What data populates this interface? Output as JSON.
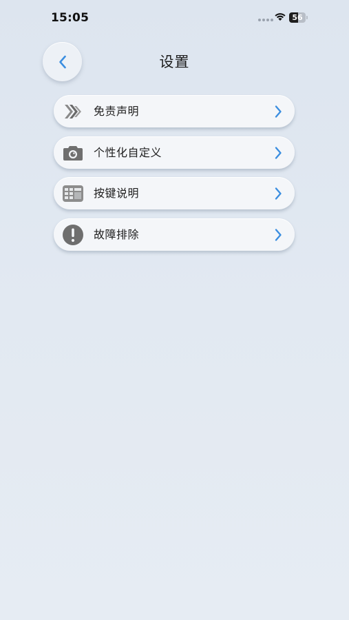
{
  "status_bar": {
    "time": "15:05",
    "battery_level": "56",
    "battery_fraction": 0.56
  },
  "header": {
    "title": "设置",
    "back_icon": "chevron-left-icon"
  },
  "menu": {
    "items": [
      {
        "label": "免责声明",
        "icon": "disclaimer-icon"
      },
      {
        "label": "个性化自定义",
        "icon": "camera-icon"
      },
      {
        "label": "按键说明",
        "icon": "keyboard-icon"
      },
      {
        "label": "故障排除",
        "icon": "exclamation-icon"
      }
    ]
  },
  "colors": {
    "accent": "#3b8ee0",
    "icon_gray": "#6f6f6f",
    "background": "#dfe6ef"
  }
}
